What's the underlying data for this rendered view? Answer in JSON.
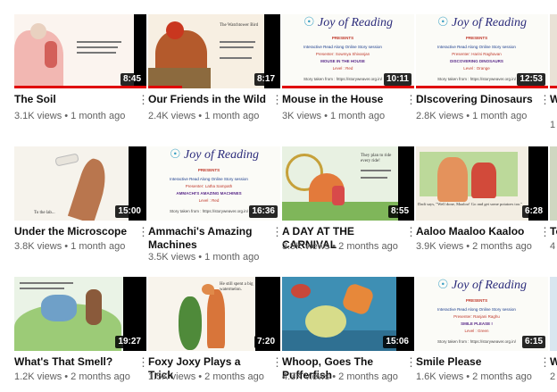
{
  "videos": [
    {
      "title": "The Soil",
      "views": "3.1K views",
      "age": "1 month ago",
      "duration": "8:45"
    },
    {
      "title": "Our Friends in the Wild",
      "views": "2.4K views",
      "age": "1 month ago",
      "duration": "8:17",
      "thumb_text": "The Watchtower Bird"
    },
    {
      "title": "Mouse in the House",
      "views": "3K views",
      "age": "1 month ago",
      "duration": "10:11",
      "poster": {
        "header": "Joy of Reading",
        "presents": "PRESENTS",
        "sub": "Interactive Read Along Online Story session",
        "presenter": "Presenter: Sowmya Shivanjan",
        "story": "MOUSE IN THE HOUSE",
        "level": "Level : Red",
        "url": "Story taken from : https://storyweaver.org.in/"
      }
    },
    {
      "title": "DIscovering Dinosaurs",
      "views": "2.8K views",
      "age": "1 month ago",
      "duration": "12:53",
      "poster": {
        "header": "Joy of Reading",
        "presents": "PRESENTS",
        "sub": "Interactive Read Along Online Story session",
        "presenter": "Presenter: Harini Raghavan",
        "story": "DISCOVERING DINOSAURS",
        "level": "Level : Orange",
        "url": "Story taken from : https://storyweaver.org.in/"
      }
    },
    {
      "title": "Under the Microscope",
      "views": "3.8K views",
      "age": "1 month ago",
      "duration": "15:00",
      "thumb_text": "To the lab..."
    },
    {
      "title": "Ammachi's Amazing Machines",
      "views": "3.5K views",
      "age": "1 month ago",
      "duration": "16:36",
      "poster": {
        "header": "Joy of Reading",
        "presents": "PRESENTS",
        "sub": "Interactive Read Along Online Story session",
        "presenter": "Presenter: Latha Sampath",
        "story": "AMMACHI'S AMAZING MACHINES",
        "level": "Level : Red",
        "url": "Story taken from : https://storyweaver.org.in/"
      }
    },
    {
      "title": "A DAY AT THE CARNIVAL",
      "views": "3.9K views",
      "age": "2 months ago",
      "duration": "8:55",
      "thumb_text": "They plan to ride every ride!"
    },
    {
      "title": "Aaloo Maaloo Kaaloo",
      "views": "3.9K views",
      "age": "2 months ago",
      "duration": "6:28",
      "thumb_text": "Dadi says, \"Well done, Maaloo! Go and get some potatoes too.\""
    },
    {
      "title": "What's That Smell?",
      "views": "1.2K views",
      "age": "2 months ago",
      "duration": "19:27"
    },
    {
      "title": "Foxy Joxy Plays a Trick",
      "views": "1.5K views",
      "age": "2 months ago",
      "duration": "7:20",
      "thumb_text": "He still spent a big watermelon."
    },
    {
      "title": "Whoop, Goes The Pufferfish",
      "views": "4.3K views",
      "age": "2 months ago",
      "duration": "15:06"
    },
    {
      "title": "Smile Please",
      "views": "1.6K views",
      "age": "2 months ago",
      "duration": "6:15",
      "poster": {
        "header": "Joy of Reading",
        "presents": "PRESENTS",
        "sub": "Interactive Read Along Online Story session",
        "presenter": "Presenter: Ranjani Raghu",
        "story": "SMILE PLEASE !",
        "level": "Level : Green",
        "url": "Story taken from : https://storyweaver.org.in/"
      }
    }
  ],
  "partial_column": [
    {
      "title_fragment": "W",
      "meta_fragment": "1"
    },
    {
      "title_fragment": "To",
      "meta_fragment": "4"
    },
    {
      "title_fragment": "W",
      "meta_fragment": "2"
    }
  ],
  "colors": {
    "progress": "#e00000",
    "title": "#0f0f0f",
    "meta": "#606060"
  }
}
